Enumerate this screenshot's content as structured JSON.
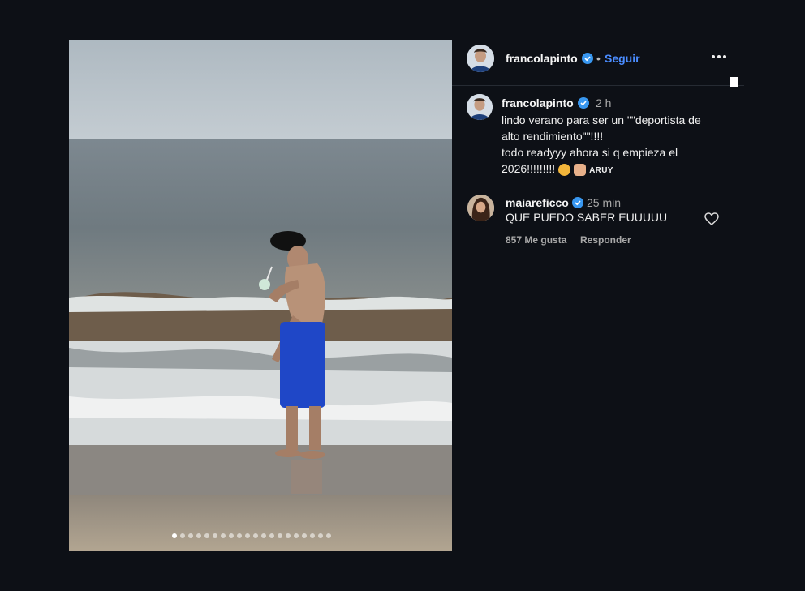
{
  "post": {
    "author": {
      "username": "francolapinto",
      "follow_label": "Seguir",
      "separator": "•"
    },
    "caption": {
      "username": "francolapinto",
      "time": "2 h",
      "lines": [
        "lindo verano para ser un \"\"deportista de",
        "alto rendimiento\"\"!!!!",
        "todo readyyy ahora si q empieza el",
        "2026!!!!!!!!!"
      ],
      "tag": "ARUY"
    },
    "comment": {
      "username": "maiareficco",
      "time": "25 min",
      "text": "QUE PUEDO SABER EUUUUU",
      "likes": "857 Me gusta",
      "reply_label": "Responder"
    },
    "media": {
      "carousel_count": 20,
      "carousel_active": 1
    }
  },
  "icons": {
    "verified": "verified-badge-icon",
    "more": "more-options-icon",
    "heart": "heart-outline-icon",
    "mute": "muted-speaker-icon",
    "next": "chevron-right-icon"
  },
  "colors": {
    "background": "#0d1016",
    "accent": "#4a8cff",
    "muted_text": "#a8a8a8"
  }
}
